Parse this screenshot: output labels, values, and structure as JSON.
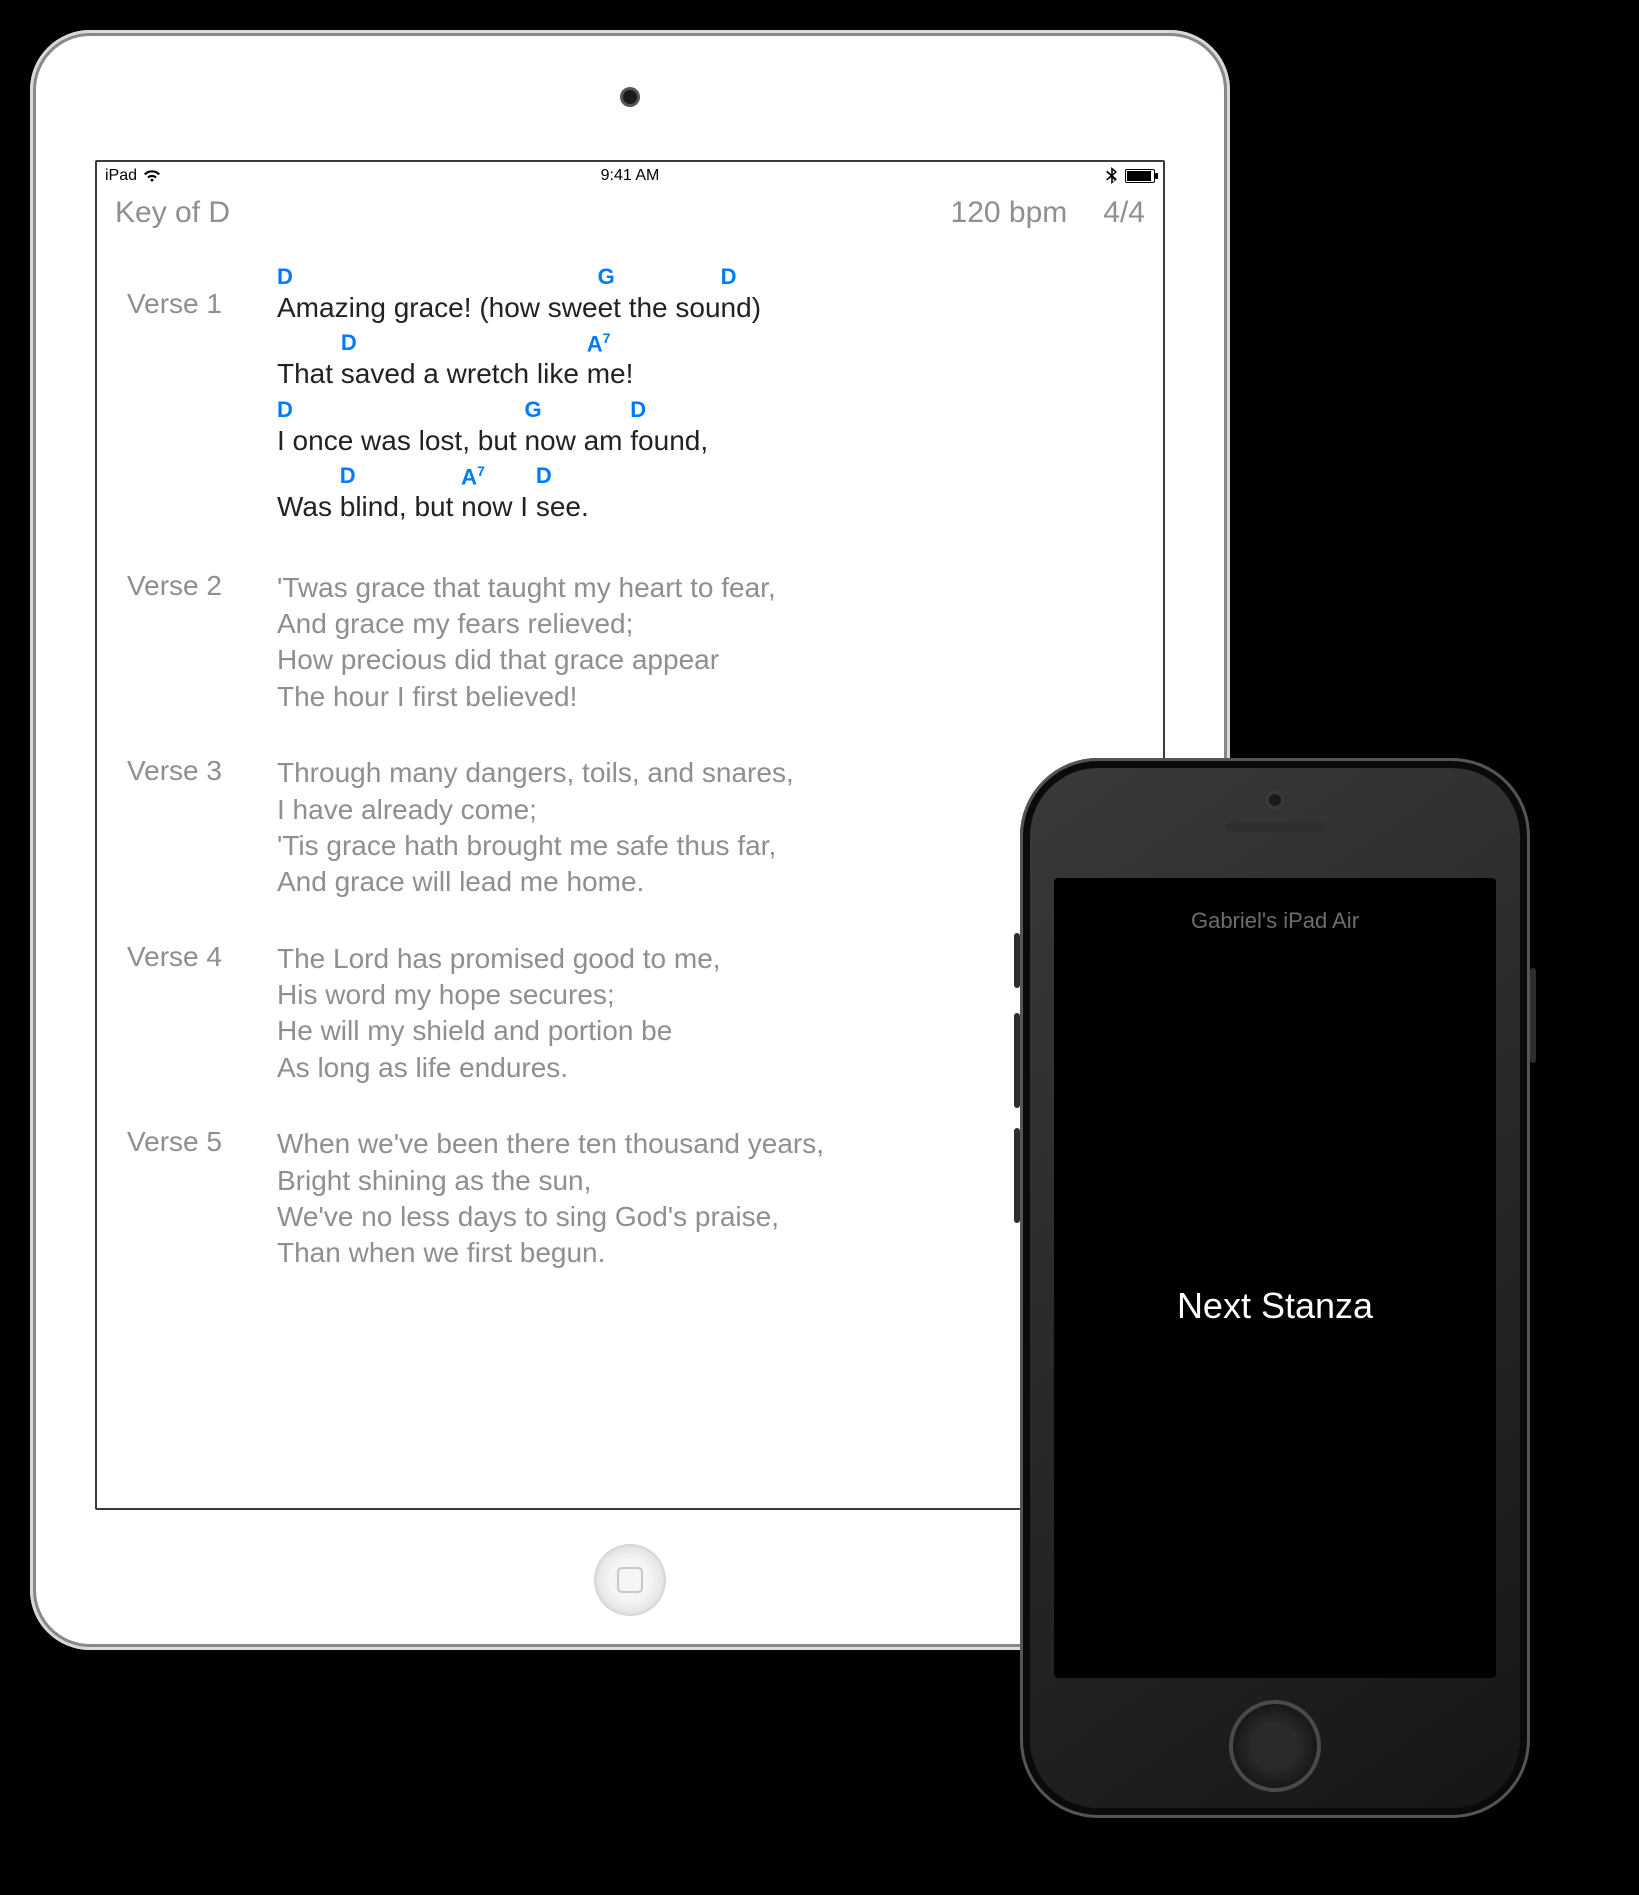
{
  "ipad": {
    "statusbar": {
      "device": "iPad",
      "time": "9:41 AM"
    },
    "toolbar": {
      "key": "Key of D",
      "bpm": "120 bpm",
      "time_signature": "4/4"
    },
    "chord_color": "#007aff",
    "verses": [
      {
        "label": "Verse 1",
        "active": true,
        "lines": [
          {
            "lyric": "Amazing grace! (how sweet the sound)",
            "chords": [
              {
                "t": "D",
                "at": 0
              },
              {
                "t": "G",
                "at": 23
              },
              {
                "t": "D",
                "at": 33
              }
            ]
          },
          {
            "lyric": "That saved a wretch like me!",
            "chords": [
              {
                "t": "D",
                "at": 5
              },
              {
                "t": "A",
                "sup": "7",
                "at": 25
              }
            ]
          },
          {
            "lyric": "I once was lost, but now am found,",
            "chords": [
              {
                "t": "D",
                "at": 0
              },
              {
                "t": "G",
                "at": 21
              },
              {
                "t": "D",
                "at": 28
              }
            ]
          },
          {
            "lyric": "Was blind, but now I see.",
            "chords": [
              {
                "t": "D",
                "at": 4
              },
              {
                "t": "A",
                "sup": "7",
                "at": 15
              },
              {
                "t": "D",
                "at": 21
              }
            ]
          }
        ]
      },
      {
        "label": "Verse 2",
        "active": false,
        "lines": [
          {
            "lyric": "'Twas grace that taught my heart to fear,"
          },
          {
            "lyric": "And grace my fears relieved;"
          },
          {
            "lyric": "How precious did that grace appear"
          },
          {
            "lyric": "The hour I first believed!"
          }
        ]
      },
      {
        "label": "Verse 3",
        "active": false,
        "lines": [
          {
            "lyric": "Through many dangers, toils, and snares,"
          },
          {
            "lyric": "I have already come;"
          },
          {
            "lyric": "'Tis grace hath brought me safe thus far,"
          },
          {
            "lyric": "And grace will lead me home."
          }
        ]
      },
      {
        "label": "Verse 4",
        "active": false,
        "lines": [
          {
            "lyric": "The Lord has promised good to me,"
          },
          {
            "lyric": "His word my hope secures;"
          },
          {
            "lyric": "He will my shield and portion be"
          },
          {
            "lyric": "As long as life endures."
          }
        ]
      },
      {
        "label": "Verse 5",
        "active": false,
        "lines": [
          {
            "lyric": "When we've been there ten thousand years,"
          },
          {
            "lyric": "Bright shining as the sun,"
          },
          {
            "lyric": "We've no less days to sing God's praise,"
          },
          {
            "lyric": "Than when we first begun."
          }
        ]
      }
    ]
  },
  "iphone": {
    "connected_device": "Gabriel's iPad Air",
    "button_label": "Next Stanza"
  }
}
